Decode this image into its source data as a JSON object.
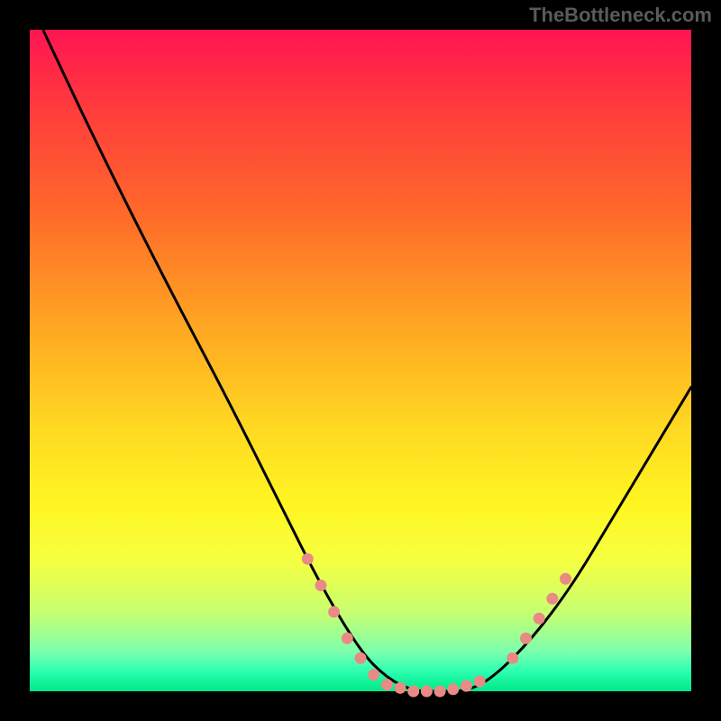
{
  "watermark": "TheBottleneck.com",
  "chart_data": {
    "type": "line",
    "title": "",
    "xlabel": "",
    "ylabel": "",
    "xlim": [
      0,
      100
    ],
    "ylim": [
      0,
      100
    ],
    "grid": false,
    "series": [
      {
        "name": "curve",
        "color": "#000000",
        "x": [
          2,
          10,
          20,
          30,
          38,
          44,
          50,
          54,
          58,
          62,
          66,
          70,
          76,
          82,
          88,
          94,
          100
        ],
        "y": [
          100,
          83,
          63,
          44,
          28,
          16,
          6,
          2,
          0,
          0,
          0,
          2,
          8,
          16,
          26,
          36,
          46
        ]
      }
    ],
    "markers": [
      {
        "name": "left-dots",
        "color": "#e98b84",
        "x": [
          42,
          44,
          46,
          48,
          50,
          52
        ],
        "y": [
          20,
          16,
          12,
          8,
          5,
          2.5
        ]
      },
      {
        "name": "bottom-dots",
        "color": "#e98b84",
        "x": [
          54,
          56,
          58,
          60,
          62,
          64,
          66,
          68
        ],
        "y": [
          1,
          0.5,
          0,
          0,
          0,
          0.3,
          0.8,
          1.5
        ]
      },
      {
        "name": "right-dots",
        "color": "#e98b84",
        "x": [
          73,
          75,
          77,
          79,
          81
        ],
        "y": [
          5,
          8,
          11,
          14,
          17
        ]
      }
    ],
    "background": {
      "type": "vertical-gradient",
      "stops": [
        {
          "pos": 0,
          "color": "#ff1452"
        },
        {
          "pos": 12,
          "color": "#ff3c3c"
        },
        {
          "pos": 28,
          "color": "#ff6a2a"
        },
        {
          "pos": 45,
          "color": "#ffa722"
        },
        {
          "pos": 60,
          "color": "#ffd822"
        },
        {
          "pos": 72,
          "color": "#fff622"
        },
        {
          "pos": 80,
          "color": "#f6ff40"
        },
        {
          "pos": 88,
          "color": "#c8ff70"
        },
        {
          "pos": 94,
          "color": "#7dffad"
        },
        {
          "pos": 97,
          "color": "#2bffb0"
        },
        {
          "pos": 100,
          "color": "#00e888"
        }
      ]
    }
  }
}
